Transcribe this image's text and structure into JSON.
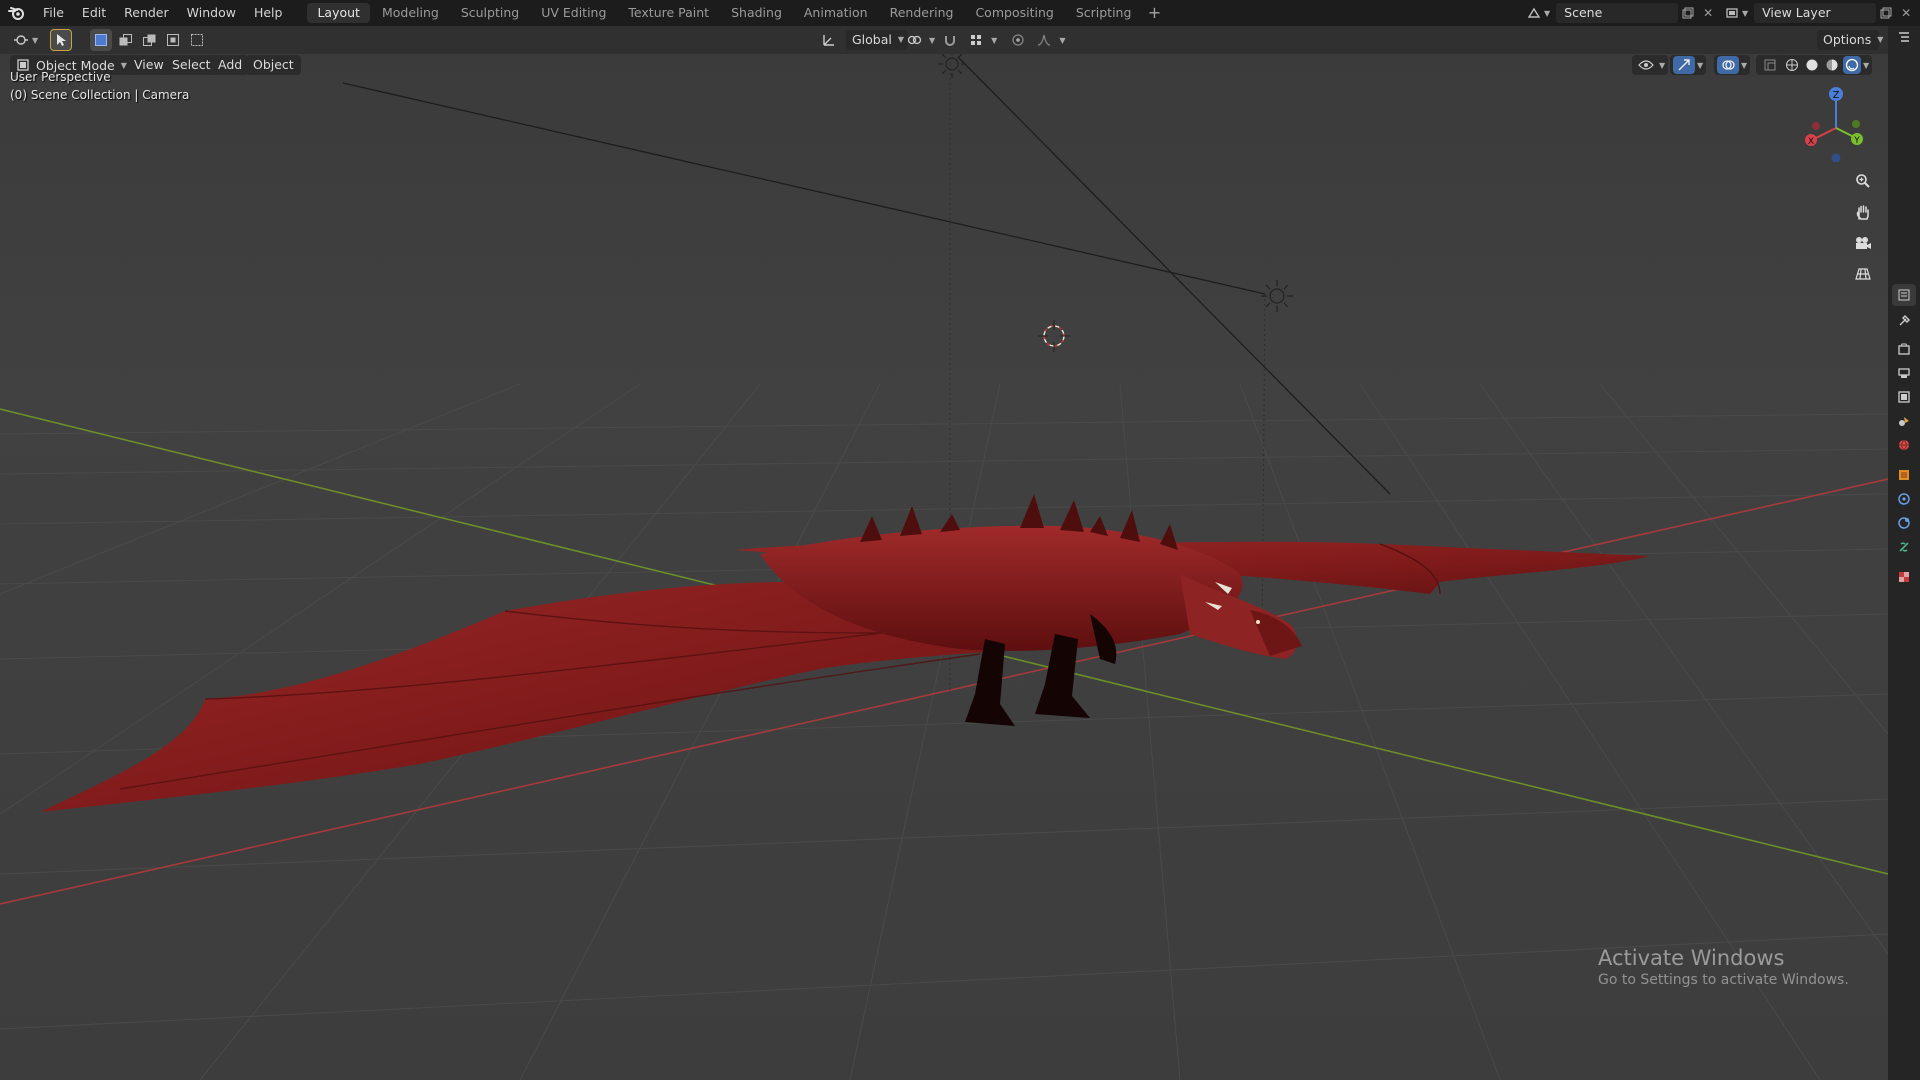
{
  "topbar": {
    "menus": [
      "File",
      "Edit",
      "Render",
      "Window",
      "Help"
    ],
    "workspaces": [
      "Layout",
      "Modeling",
      "Sculpting",
      "UV Editing",
      "Texture Paint",
      "Shading",
      "Animation",
      "Rendering",
      "Compositing",
      "Scripting"
    ],
    "active_workspace": "Layout",
    "add_workspace": "+",
    "scene_name": "Scene",
    "view_layer_name": "View Layer"
  },
  "toolrow": {
    "transform_orientation": "Global",
    "options_label": "Options"
  },
  "viewport": {
    "mode": "Object Mode",
    "menus": [
      "View",
      "Select",
      "Add",
      "Object"
    ],
    "perspective": "User Perspective",
    "collection_info": "(0) Scene Collection | Camera",
    "gizmo_axes": {
      "x": "X",
      "y": "Y",
      "z": "Z"
    },
    "object_color": "#8a1c1c",
    "x_axis_color": "#a6393c",
    "y_axis_color": "#6b8e2a"
  },
  "watermark": {
    "title": "Activate Windows",
    "subtitle": "Go to Settings to activate Windows."
  },
  "icons": {
    "blender": "blender-logo-icon",
    "editor_type": "3d-viewport-icon",
    "select": "select-box-icon",
    "nav": [
      "zoom-icon",
      "pan-hand-icon",
      "camera-view-icon",
      "ortho-grid-icon"
    ],
    "properties": [
      "tool-icon",
      "render-icon",
      "output-icon",
      "view-layer-icon",
      "scene-icon",
      "world-icon",
      "object-icon",
      "modifier-icon",
      "physics-icon",
      "constraint-icon",
      "data-icon",
      "texture-icon"
    ]
  }
}
